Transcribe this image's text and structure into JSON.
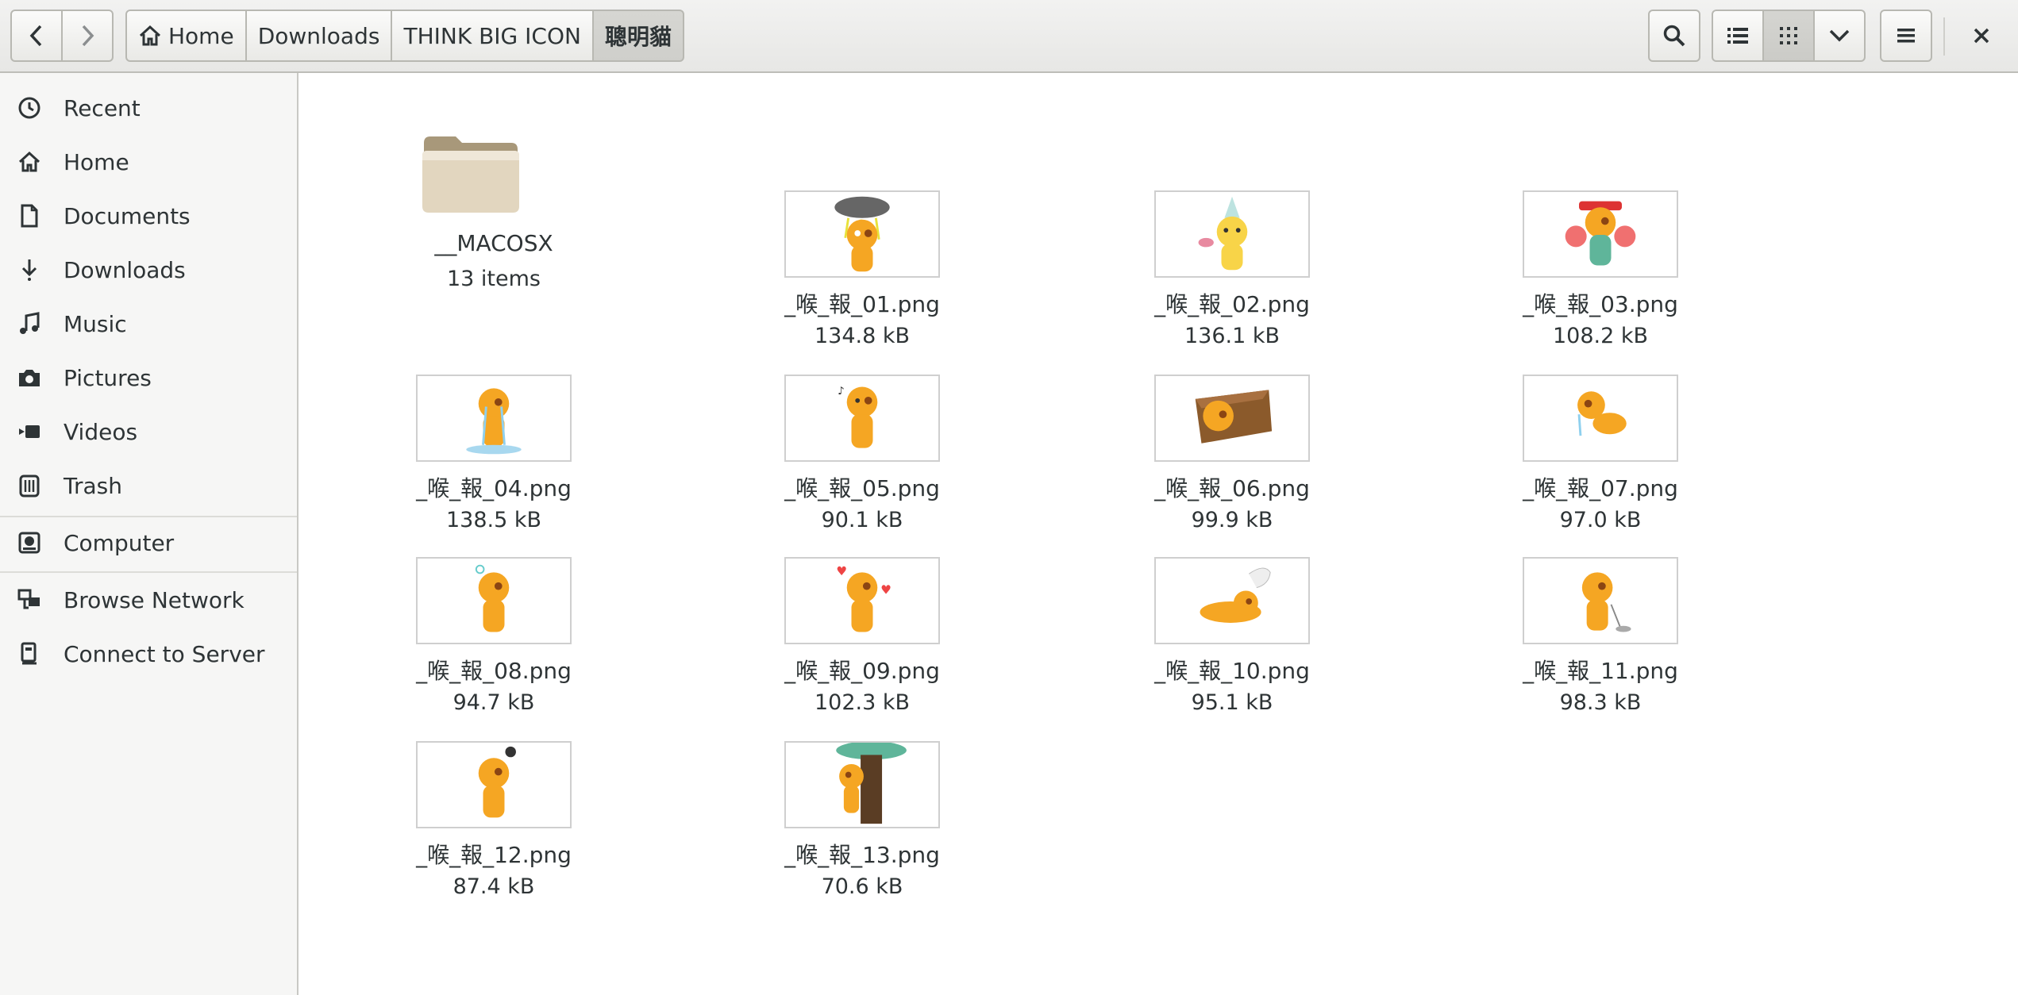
{
  "header": {
    "breadcrumbs": [
      "Home",
      "Downloads",
      "THINK BIG ICON",
      "聰明貓"
    ],
    "icons": {
      "back": "chevron-left-icon",
      "forward": "chevron-right-icon",
      "home": "home-icon",
      "search": "search-icon",
      "list_view": "list-view-icon",
      "grid_view": "grid-view-icon",
      "view_options": "chevron-down-icon",
      "menu": "hamburger-menu-icon",
      "close": "close-icon"
    }
  },
  "sidebar": {
    "items": [
      {
        "label": "Recent",
        "icon": "clock-icon"
      },
      {
        "label": "Home",
        "icon": "home-icon"
      },
      {
        "label": "Documents",
        "icon": "document-icon"
      },
      {
        "label": "Downloads",
        "icon": "download-arrow-icon"
      },
      {
        "label": "Music",
        "icon": "music-note-icon"
      },
      {
        "label": "Pictures",
        "icon": "camera-icon"
      },
      {
        "label": "Videos",
        "icon": "video-camera-icon"
      },
      {
        "label": "Trash",
        "icon": "trash-icon"
      },
      {
        "label": "Computer",
        "icon": "hard-drive-icon"
      },
      {
        "label": "Browse Network",
        "icon": "network-icon"
      },
      {
        "label": "Connect to Server",
        "icon": "server-icon"
      }
    ]
  },
  "files": [
    {
      "name": "__MACOSX",
      "size": "13 items",
      "type": "folder"
    },
    {
      "name": "_喉_報_01.png",
      "size": "134.8 kB",
      "type": "image"
    },
    {
      "name": "_喉_報_02.png",
      "size": "136.1 kB",
      "type": "image"
    },
    {
      "name": "_喉_報_03.png",
      "size": "108.2 kB",
      "type": "image"
    },
    {
      "name": "_喉_報_04.png",
      "size": "138.5 kB",
      "type": "image"
    },
    {
      "name": "_喉_報_05.png",
      "size": "90.1 kB",
      "type": "image"
    },
    {
      "name": "_喉_報_06.png",
      "size": "99.9 kB",
      "type": "image"
    },
    {
      "name": "_喉_報_07.png",
      "size": "97.0 kB",
      "type": "image"
    },
    {
      "name": "_喉_報_08.png",
      "size": "94.7 kB",
      "type": "image"
    },
    {
      "name": "_喉_報_09.png",
      "size": "102.3 kB",
      "type": "image"
    },
    {
      "name": "_喉_報_10.png",
      "size": "95.1 kB",
      "type": "image"
    },
    {
      "name": "_喉_報_11.png",
      "size": "98.3 kB",
      "type": "image"
    },
    {
      "name": "_喉_報_12.png",
      "size": "87.4 kB",
      "type": "image"
    },
    {
      "name": "_喉_報_13.png",
      "size": "70.6 kB",
      "type": "image"
    }
  ],
  "colors": {
    "accent": "#f6a623",
    "cat_orange": "#f5a623",
    "folder": "#d8cbb3"
  }
}
